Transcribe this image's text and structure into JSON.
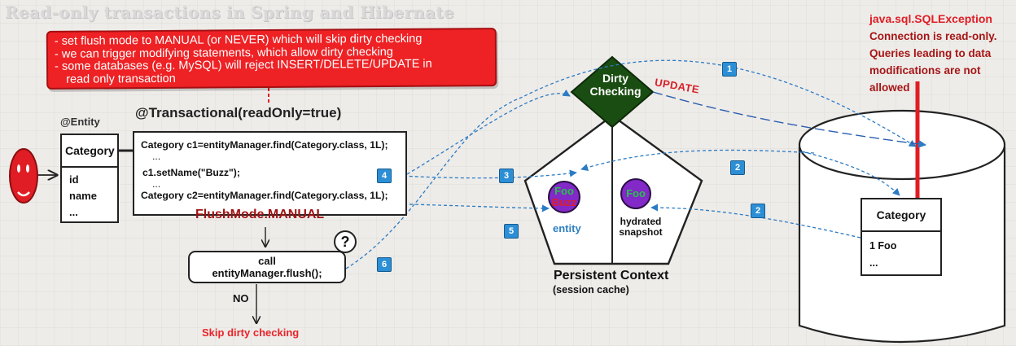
{
  "title": "Read-only transactions in Spring and Hibernate",
  "note": {
    "lines": [
      "- set flush mode to MANUAL (or NEVER) which will skip dirty checking",
      "- we can trigger modifying statements, which allow dirty checking",
      "- some databases (e.g. MySQL) will reject INSERT/DELETE/UPDATE in",
      "read only transaction"
    ]
  },
  "transactional_label": "@Transactional(readOnly=true)",
  "entity": {
    "annotation": "@Entity",
    "name": "Category",
    "fields": [
      "id",
      "name",
      "..."
    ]
  },
  "code": {
    "line1": "Category c1=entityManager.find(Category.class, 1L);",
    "dots1": "...",
    "line2": "c1.setName(\"Buzz\");",
    "dots2": "...",
    "line3": "Category c2=entityManager.find(Category.class, 1L);"
  },
  "flush_mode": "FlushMode.MANUAL",
  "flush_call": {
    "line1": "call",
    "line2": "entityManager.flush();"
  },
  "question_mark": "?",
  "no_label": "NO",
  "skip_label": "Skip dirty checking",
  "dirty_checking": {
    "line1": "Dirty",
    "line2": "Checking"
  },
  "update_label": "UPDATE",
  "persistence_context": {
    "title": "Persistent Context",
    "subtitle": "(session cache)",
    "entity": {
      "value1": "Foo",
      "value2": "Buzz",
      "label": "entity"
    },
    "snapshot": {
      "value": "Foo",
      "label_line1": "hydrated",
      "label_line2": "snapshot"
    }
  },
  "database": {
    "exception": "java.sql.SQLException",
    "message_lines": [
      "Connection is read-only.",
      "Queries leading to data",
      "modifications are not",
      "allowed"
    ],
    "table": {
      "name": "Category",
      "rows": [
        "1 Foo",
        "..."
      ]
    }
  },
  "badges": {
    "b1": "1",
    "b2a": "2",
    "b2b": "2",
    "b3": "3",
    "b4": "4",
    "b5": "5",
    "b6": "6"
  },
  "colors": {
    "note_red": "#ee2124",
    "dirty_green": "#1a4d12",
    "arrow_blue": "#2c7bc4",
    "entity_purple": "#8229c7",
    "error_red": "#e01d24"
  }
}
